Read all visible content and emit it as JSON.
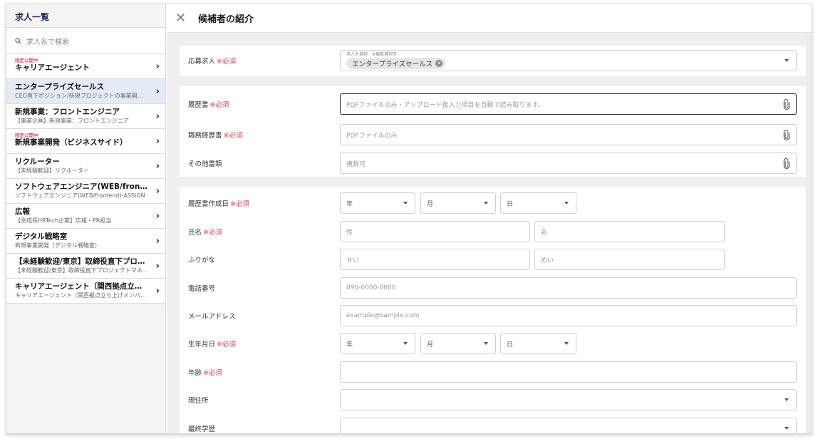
{
  "sidebar": {
    "title": "求人一覧",
    "search_placeholder": "求人名で検索",
    "items": [
      {
        "badge": "限定公開中",
        "title": "キャリアエージェント",
        "sub": ""
      },
      {
        "badge": "",
        "title": "エンタープライズセールス",
        "sub": "CEO直下ポジション/新規プロジェクトの事業開発責任者"
      },
      {
        "badge": "",
        "title": "新規事業：フロントエンジニア",
        "sub": "【事業企画】新規事業：フロントエンジニア"
      },
      {
        "badge": "限定公開中",
        "title": "新規事業開発（ビジネスサイド）",
        "sub": ""
      },
      {
        "badge": "",
        "title": "リクルーター",
        "sub": "【未経験歓迎】リクルーター"
      },
      {
        "badge": "",
        "title": "ソフトウェアエンジニア(WEB/frontend)",
        "sub": "ソフトウェアエンジニア(WEB/frontend)-ASSIGN"
      },
      {
        "badge": "",
        "title": "広報",
        "sub": "【急成長HRTech企業】広報・PR担当"
      },
      {
        "badge": "",
        "title": "デジタル戦略室",
        "sub": "新規事業開発（デジタル戦略室）"
      },
      {
        "badge": "",
        "title": "【未経験歓迎/東京】取締役直下プロジェクト",
        "sub": "【未経験歓迎/東京】取締役直下プロジェクトマネージャー"
      },
      {
        "badge": "",
        "title": "キャリアエージェント（関西拠点立ち上げ）",
        "sub": "キャリアエージェント（関西拠点立ち上げメンバー）"
      }
    ],
    "selected_index": 1
  },
  "header": {
    "title": "候補者の紹介"
  },
  "form": {
    "required_mark": "※必須",
    "job": {
      "label": "応募求人",
      "hint": "求人を選択　※複数選択可",
      "chip": "エンタープライズセールス"
    },
    "resume": {
      "label": "履歴書",
      "placeholder": "PDFファイルのみ・アップロード後入力項目を自動で読み取ります。"
    },
    "cv": {
      "label": "職務経歴書",
      "placeholder": "PDFファイルのみ"
    },
    "other_docs": {
      "label": "その他書類",
      "placeholder": "複数可"
    },
    "resume_date": {
      "label": "履歴書作成日",
      "year": "年",
      "month": "月",
      "day": "日"
    },
    "name": {
      "label": "氏名",
      "last": "性",
      "first": "名"
    },
    "kana": {
      "label": "ふりがな",
      "last": "せい",
      "first": "めい"
    },
    "phone": {
      "label": "電話番号",
      "placeholder": "090-0000-0000"
    },
    "email": {
      "label": "メールアドレス",
      "placeholder": "example@sample.com"
    },
    "birthdate": {
      "label": "生年月日",
      "year": "年",
      "month": "月",
      "day": "日"
    },
    "age": {
      "label": "年齢",
      "placeholder": ""
    },
    "address": {
      "label": "現住所",
      "value": ""
    },
    "education": {
      "label": "最終学歴",
      "value": ""
    }
  }
}
